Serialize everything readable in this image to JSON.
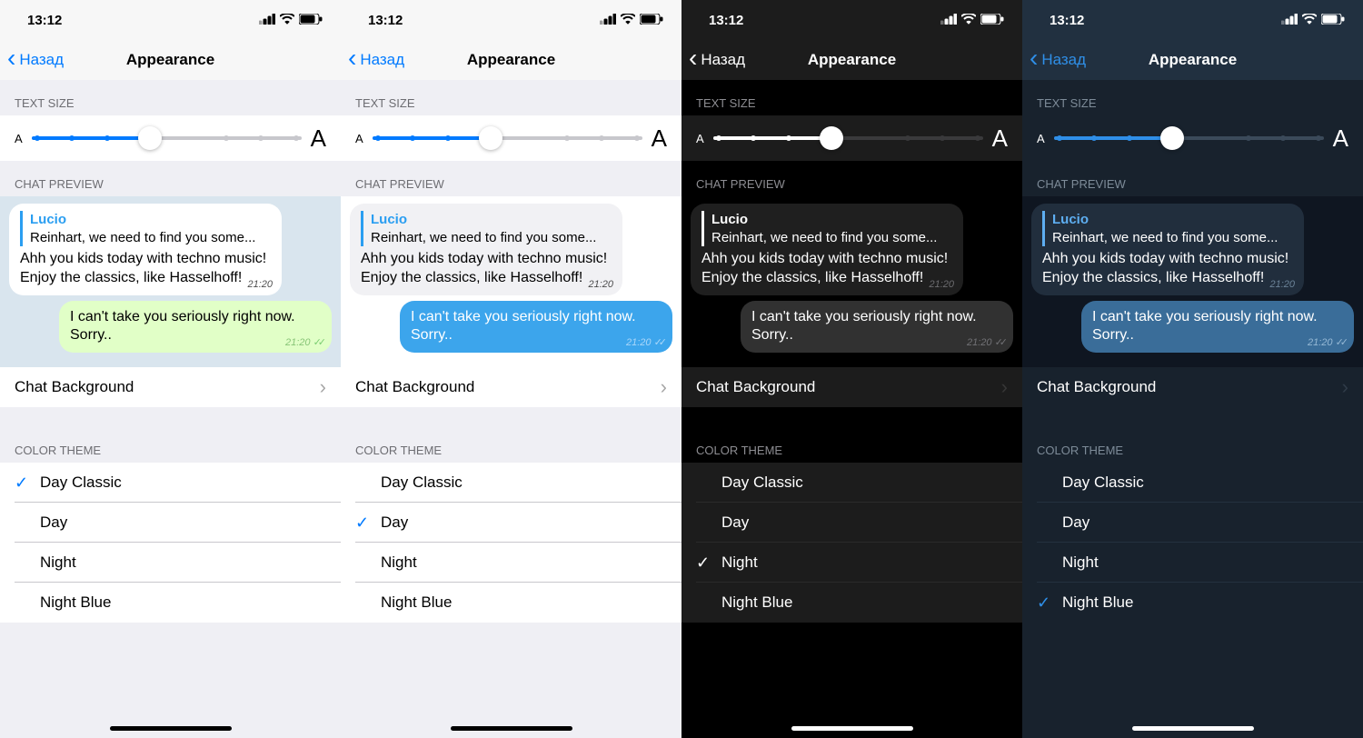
{
  "status": {
    "time": "13:12"
  },
  "nav": {
    "back": "Назад",
    "title": "Appearance"
  },
  "sections": {
    "text_size": "TEXT SIZE",
    "chat_preview": "CHAT PREVIEW",
    "color_theme": "COLOR THEME"
  },
  "chat": {
    "quote_name": "Lucio",
    "quote_text": "Reinhart, we need to find you some...",
    "in_text": "Ahh you kids today with techno music! Enjoy the classics, like Hasselhoff!",
    "in_time": "21:20",
    "out_text": "I can't take you seriously right now. Sorry..",
    "out_time": "21:20"
  },
  "chat_bg_label": "Chat Background",
  "themes": [
    "Day Classic",
    "Day",
    "Night",
    "Night Blue"
  ],
  "panels": [
    {
      "selected_index": 0
    },
    {
      "selected_index": 1
    },
    {
      "selected_index": 2
    },
    {
      "selected_index": 3
    }
  ],
  "slider": {
    "small": "A",
    "big": "A",
    "value_pct": 44
  }
}
